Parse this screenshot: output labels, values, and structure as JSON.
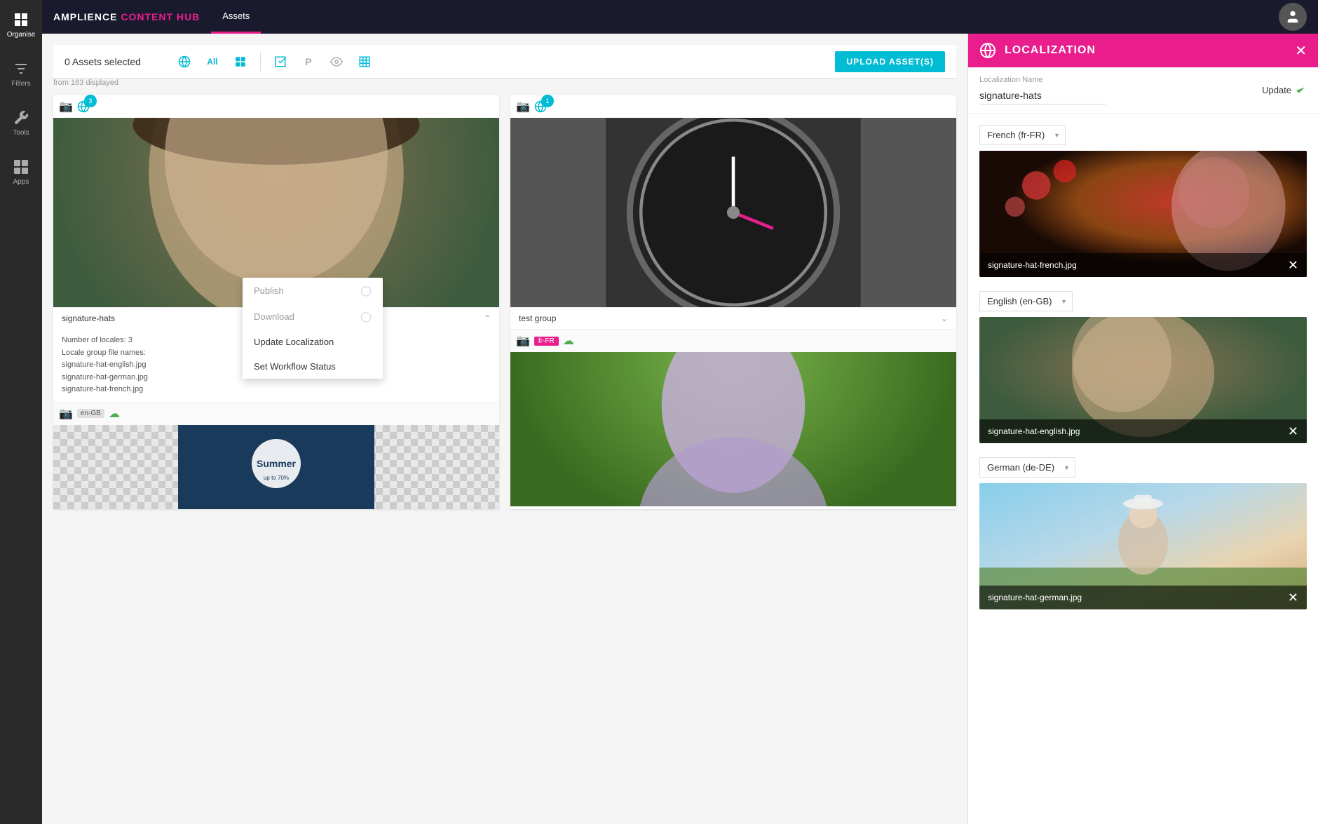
{
  "brand": {
    "name_plain": "AMPLIENCE",
    "name_highlight": "CONTENT HUB"
  },
  "topbar": {
    "nav_tab": "Assets"
  },
  "toolbar": {
    "asset_count": "0 Assets selected",
    "from_text": "from 163 displayed",
    "upload_label": "UPLOAD ASSET(S)"
  },
  "sidebar": {
    "items": [
      {
        "label": "Organise",
        "icon": "grid-icon"
      },
      {
        "label": "Filters",
        "icon": "filter-icon"
      },
      {
        "label": "Tools",
        "icon": "tools-icon"
      },
      {
        "label": "Apps",
        "icon": "apps-icon"
      }
    ]
  },
  "assets": [
    {
      "id": "asset-1",
      "name": "signature-hats",
      "locale_count": "3",
      "expanded": true,
      "info": {
        "locales_label": "Number of locales: 3",
        "group_label": "Locale group file names:",
        "files": [
          "signature-hat-english.jpg",
          "signature-hat-german.jpg",
          "signature-hat-french.jpg"
        ]
      },
      "sub_asset": {
        "locale_badge": "en-GB",
        "has_cloud": true
      }
    },
    {
      "id": "asset-2",
      "name": "test group",
      "locale_count": "1",
      "expanded": false,
      "sub_asset": {
        "locale_badge": "fr-FR",
        "has_cloud": true
      }
    }
  ],
  "context_menu": {
    "items": [
      {
        "label": "Publish",
        "disabled": true
      },
      {
        "label": "Download",
        "disabled": true
      },
      {
        "label": "Update Localization",
        "disabled": false
      },
      {
        "label": "Set Workflow Status",
        "disabled": false
      }
    ]
  },
  "localization_panel": {
    "title": "LOCALIZATION",
    "name_label": "Localization Name",
    "name_value": "signature-hats",
    "update_label": "Update",
    "locales": [
      {
        "locale": "French (fr-FR)",
        "image_name": "signature-hat-french.jpg"
      },
      {
        "locale": "English (en-GB)",
        "image_name": "signature-hat-english.jpg"
      },
      {
        "locale": "German (de-DE)",
        "image_name": "signature-hat-german.jpg"
      }
    ]
  }
}
